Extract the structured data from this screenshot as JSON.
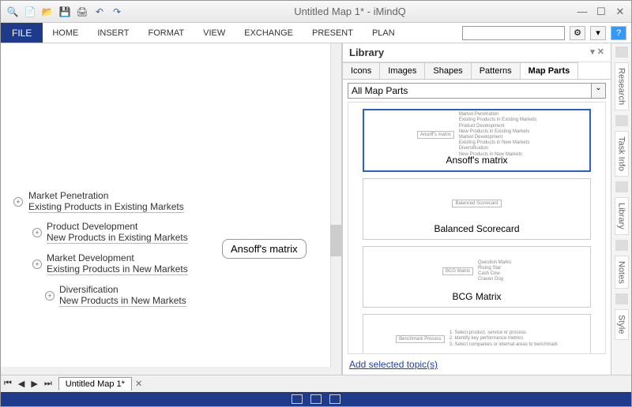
{
  "titlebar": {
    "title": "Untitled Map 1* - iMindQ"
  },
  "ribbon": {
    "file": "FILE",
    "tabs": [
      "HOME",
      "INSERT",
      "FORMAT",
      "VIEW",
      "EXCHANGE",
      "PRESENT",
      "PLAN"
    ]
  },
  "canvas": {
    "central": "Ansoff's matrix",
    "branches": [
      {
        "line1": "Market Penetration",
        "line2": "Existing Products in Existing Markets"
      },
      {
        "line1": "Product Development",
        "line2": "New Products in Existing Markets"
      },
      {
        "line1": "Market Development",
        "line2": "Existing Products in New Markets"
      },
      {
        "line1": "Diversification",
        "line2": "New Products in New Markets"
      }
    ]
  },
  "library": {
    "title": "Library",
    "tabs": [
      "Icons",
      "Images",
      "Shapes",
      "Patterns",
      "Map Parts"
    ],
    "active_tab": 4,
    "dropdown": "All Map Parts",
    "templates": [
      {
        "label": "Ansoff's matrix",
        "mini_center": "Ansoff's matrix",
        "mini_lines": [
          "Market Penetration",
          "Existing Products in Existing Markets",
          "Product Development",
          "New Products in Existing Markets",
          "Market Development",
          "Existing Products in New Markets",
          "Diversification",
          "New Products in New Markets"
        ]
      },
      {
        "label": "Balanced Scorecard",
        "mini_center": "Balanced Scorecard"
      },
      {
        "label": "BCG Matrix",
        "mini_center": "BCG Matrix",
        "mini_lines": [
          "Question Marks",
          "Rising Star",
          "Cash Cow",
          "Craven Dog"
        ]
      }
    ],
    "benchmark": "Benchmark Process",
    "bench_lines": [
      "1. Select product, service or process",
      "2. Identify key performance metrics",
      "3. Select companies or internal areas to benchmark"
    ],
    "add_link": "Add selected topic(s)"
  },
  "sidepanel": {
    "tabs": [
      "Research",
      "Task Info",
      "Library",
      "Notes",
      "Style"
    ]
  },
  "sheets": {
    "sheet1": "Untitled Map 1*"
  }
}
